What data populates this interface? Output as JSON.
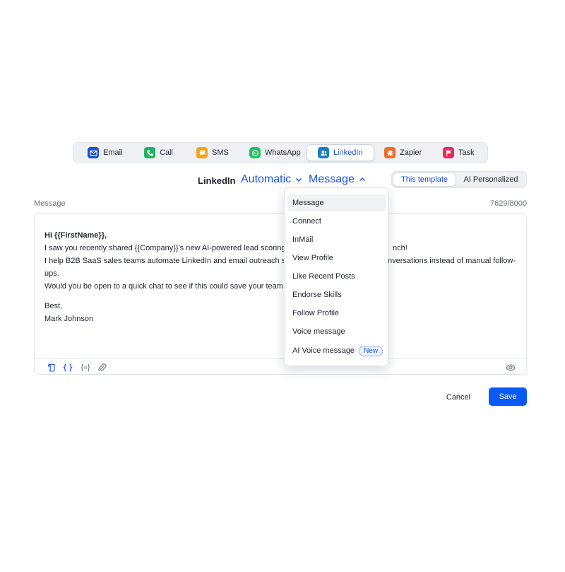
{
  "channels": [
    {
      "label": "Email",
      "icon": "envelope-icon",
      "color": "#1a4fd6"
    },
    {
      "label": "Call",
      "icon": "phone-icon",
      "color": "#22b35f"
    },
    {
      "label": "SMS",
      "icon": "chat-bubble-icon",
      "color": "#f7a21b"
    },
    {
      "label": "WhatsApp",
      "icon": "whatsapp-icon",
      "color": "#25c160"
    },
    {
      "label": "LinkedIn",
      "icon": "users-icon",
      "color": "#1b7fbf",
      "active": true
    },
    {
      "label": "Zapier",
      "icon": "asterisk-icon",
      "color": "#f26a22"
    },
    {
      "label": "Task",
      "icon": "flag-icon",
      "color": "#ec2a5a"
    }
  ],
  "header": {
    "channel_label": "LinkedIn",
    "mode_dropdown": "Automatic",
    "action_dropdown": "Message"
  },
  "template_toggle": {
    "options": [
      "This template",
      "AI Personalized"
    ],
    "active": "This template"
  },
  "editor": {
    "label": "Message",
    "counter": "7629/8000",
    "lines": {
      "greeting": "Hi {{FirstName}},",
      "line1": "I saw you recently shared {{Company}}'s new AI-powered lead scoring",
      "line1_end": "nch!",
      "line2": "I help B2B SaaS sales teams automate LinkedIn and email outreach so",
      "line2_end": "nversations instead of manual follow-",
      "line2_wrap": "ups.",
      "line3": "Would you be open to a quick chat to see if this could save your team a",
      "signoff": "Best,",
      "signature": "Mark Johnson"
    },
    "toolbar_icons": [
      "template-icon",
      "variables-icon",
      "ai-icon",
      "attachment-icon",
      "preview-eye-icon"
    ]
  },
  "action_menu": {
    "items": [
      "Message",
      "Connect",
      "InMail",
      "View Profile",
      "Like Recent Posts",
      "Endorse Skills",
      "Follow Profile",
      "Voice message",
      "AI Voice message"
    ],
    "selected": "Message",
    "new_badge": "New"
  },
  "footer": {
    "cancel_label": "Cancel",
    "save_label": "Save"
  },
  "colors": {
    "accent": "#1a56e8",
    "save_button": "#0a59f7"
  }
}
